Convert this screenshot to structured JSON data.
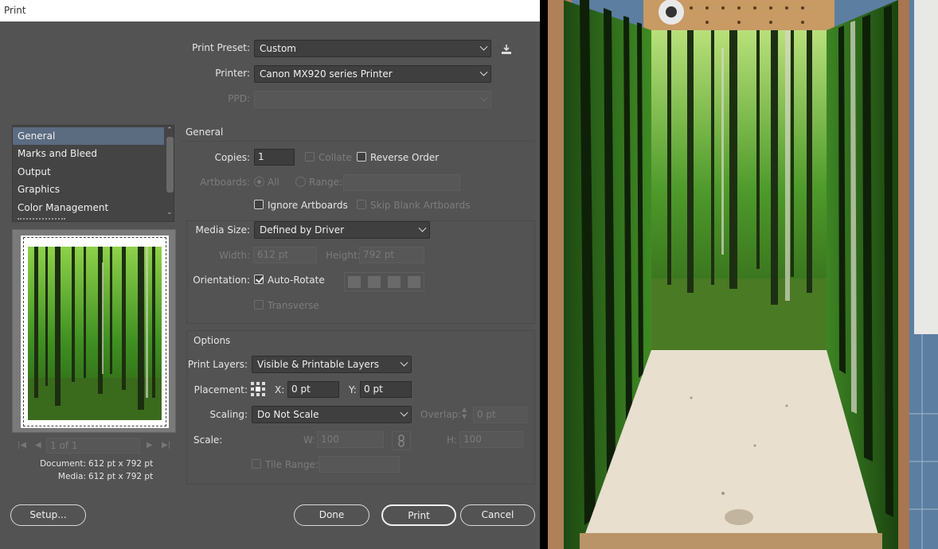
{
  "dialog": {
    "title": "Print",
    "print_preset_label": "Print Preset:",
    "print_preset_value": "Custom",
    "printer_label": "Printer:",
    "printer_value": "Canon MX920 series Printer",
    "ppd_label": "PPD:",
    "ppd_value": ""
  },
  "sidebar": {
    "items": [
      {
        "label": "General",
        "active": true
      },
      {
        "label": "Marks and Bleed"
      },
      {
        "label": "Output"
      },
      {
        "label": "Graphics"
      },
      {
        "label": "Color Management"
      }
    ]
  },
  "preview": {
    "page_indicator": "1 of 1",
    "document_label": "Document:",
    "document_value": "612 pt x 792 pt",
    "media_label": "Media:",
    "media_value": "612 pt x 792 pt"
  },
  "general": {
    "section_title": "General",
    "copies_label": "Copies:",
    "copies_value": "1",
    "collate_label": "Collate",
    "reverse_order_label": "Reverse Order",
    "artboards_label": "Artboards:",
    "all_label": "All",
    "range_label": "Range:",
    "ignore_artboards_label": "Ignore Artboards",
    "skip_blank_label": "Skip Blank Artboards",
    "media_size_label": "Media Size:",
    "media_size_value": "Defined by Driver",
    "width_label": "Width:",
    "width_value": "612 pt",
    "height_label": "Height:",
    "height_value": "792 pt",
    "orientation_label": "Orientation:",
    "auto_rotate_label": "Auto-Rotate",
    "transverse_label": "Transverse"
  },
  "options": {
    "section_title": "Options",
    "print_layers_label": "Print Layers:",
    "print_layers_value": "Visible & Printable Layers",
    "placement_label": "Placement:",
    "x_label": "X:",
    "x_value": "0 pt",
    "y_label": "Y:",
    "y_value": "0 pt",
    "scaling_label": "Scaling:",
    "scaling_value": "Do Not Scale",
    "overlap_label": "Overlap:",
    "overlap_value": "0 pt",
    "scale_label": "Scale:",
    "w_label": "W:",
    "w_value": "100",
    "h_label": "H:",
    "h_value": "100",
    "tile_range_label": "Tile Range:"
  },
  "buttons": {
    "setup": "Setup...",
    "done": "Done",
    "print": "Print",
    "cancel": "Cancel"
  },
  "colors": {
    "dialog_bg": "#535353",
    "selection": "#5b6b80",
    "forest_green": "#2f7a1a"
  }
}
